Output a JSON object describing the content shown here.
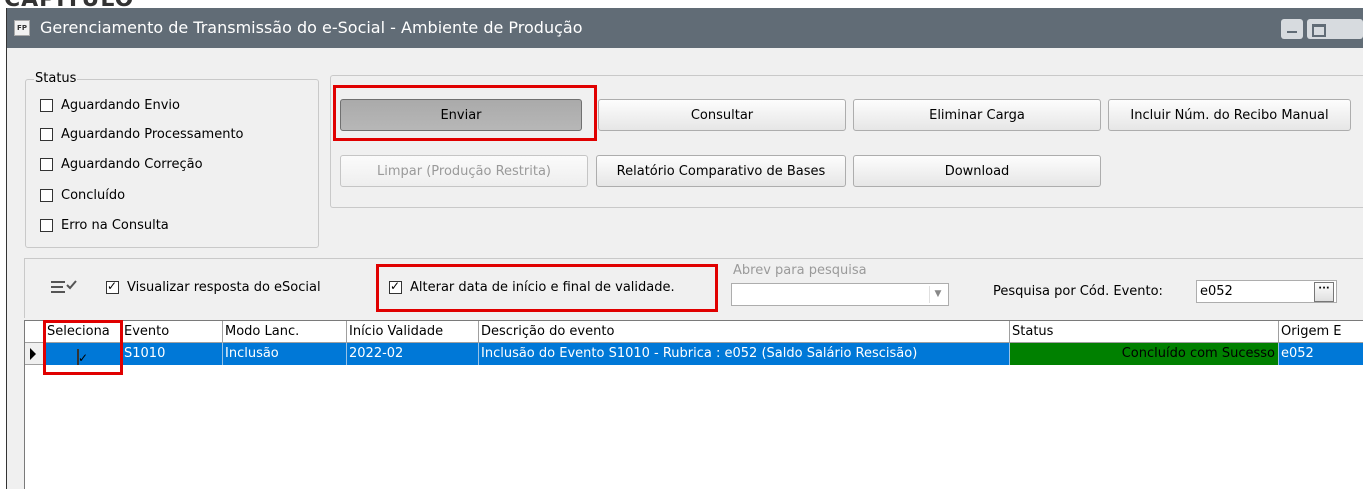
{
  "window": {
    "title": "Gerenciamento de Transmissão do e-Social - Ambiente de Produção",
    "app_icon": "FP",
    "top_clipped_text": "CAPÍTULO"
  },
  "status_group": {
    "legend": "Status",
    "items": [
      {
        "label": "Aguardando Envio",
        "checked": false
      },
      {
        "label": "Aguardando Processamento",
        "checked": false
      },
      {
        "label": "Aguardando Correção",
        "checked": false
      },
      {
        "label": "Concluído",
        "checked": false
      },
      {
        "label": "Erro na Consulta",
        "checked": false
      }
    ]
  },
  "actions": {
    "enviar": "Enviar",
    "consultar": "Consultar",
    "eliminar_carga": "Eliminar Carga",
    "incluir_recibo": "Incluir Núm. do Recibo Manual",
    "limpar": "Limpar (Produção Restrita)",
    "relatorio": "Relatório Comparativo de Bases",
    "download": "Download"
  },
  "filters": {
    "visualizar_resposta": {
      "label": "Visualizar resposta do eSocial",
      "checked": true
    },
    "alterar_data": {
      "label": "Alterar data de início e final de validade.",
      "checked": true
    },
    "abrev_label": "Abrev para pesquisa",
    "abrev_value": "",
    "pesquisa_label": "Pesquisa por Cód. Evento:",
    "pesquisa_value": "e052",
    "dots": "···"
  },
  "grid": {
    "columns": [
      "Seleciona",
      "Evento",
      "Modo Lanc.",
      "Início Validade",
      "Descrição do evento",
      "Status",
      "Origem E"
    ],
    "rows": [
      {
        "selected": true,
        "evento": "S1010",
        "modo": "Inclusão",
        "inicio": "2022-02",
        "descricao": "Inclusão do Evento S1010 - Rubrica : e052 (Saldo Salário Rescisão)",
        "status": "Concluído com Sucesso",
        "origem": "e052"
      }
    ]
  },
  "colors": {
    "titlebar": "#616c76",
    "row_selected": "#0078d7",
    "status_success": "#008000",
    "highlight": "#e00000"
  }
}
